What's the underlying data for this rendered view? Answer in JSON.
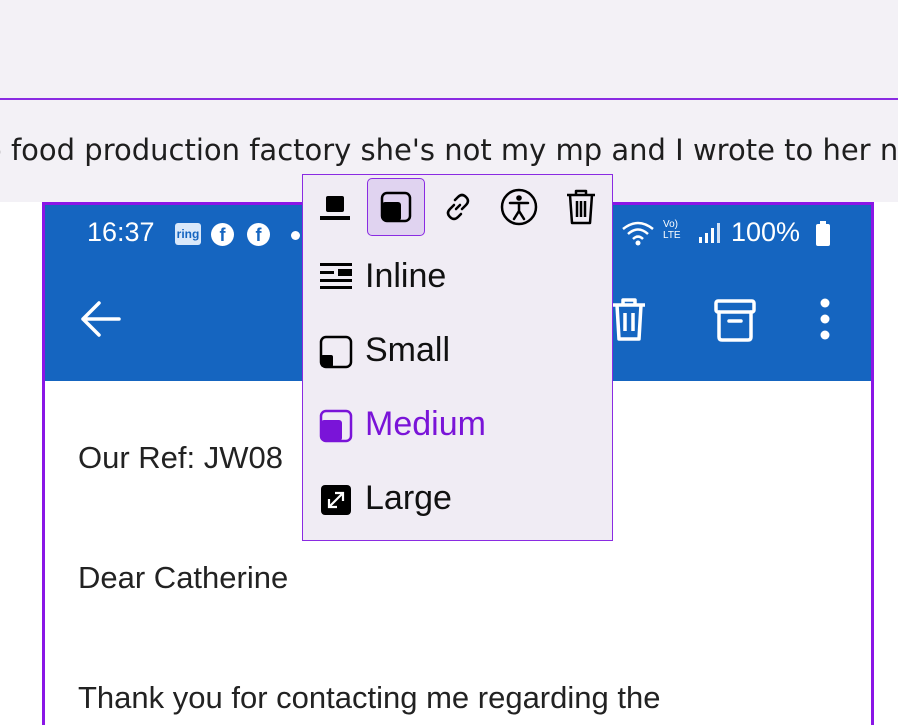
{
  "post": {
    "text": "o food production factory she's not my mp and I wrote to her n"
  },
  "phone": {
    "status_time": "16:37",
    "ring_label": "ring",
    "battery": "100%"
  },
  "email": {
    "ref": "Our Ref: JW08",
    "greeting": "Dear Catherine",
    "body_start": "Thank you for contacting me regarding the"
  },
  "toolbar": {
    "buttons": [
      {
        "icon": "align-block-icon"
      },
      {
        "icon": "size-medium-icon",
        "active": true
      },
      {
        "icon": "link-icon"
      },
      {
        "icon": "accessibility-icon"
      },
      {
        "icon": "trash-icon"
      }
    ]
  },
  "size_menu": {
    "items": [
      {
        "label": "Inline",
        "icon": "inline-icon"
      },
      {
        "label": "Small",
        "icon": "size-small-icon"
      },
      {
        "label": "Medium",
        "icon": "size-medium-icon",
        "selected": true
      },
      {
        "label": "Large",
        "icon": "size-large-icon"
      }
    ]
  },
  "colors": {
    "accent": "#8a2be2",
    "selected_text": "#7a14d8",
    "app_blue": "#1565c0",
    "popup_bg": "#f0ecf4"
  }
}
